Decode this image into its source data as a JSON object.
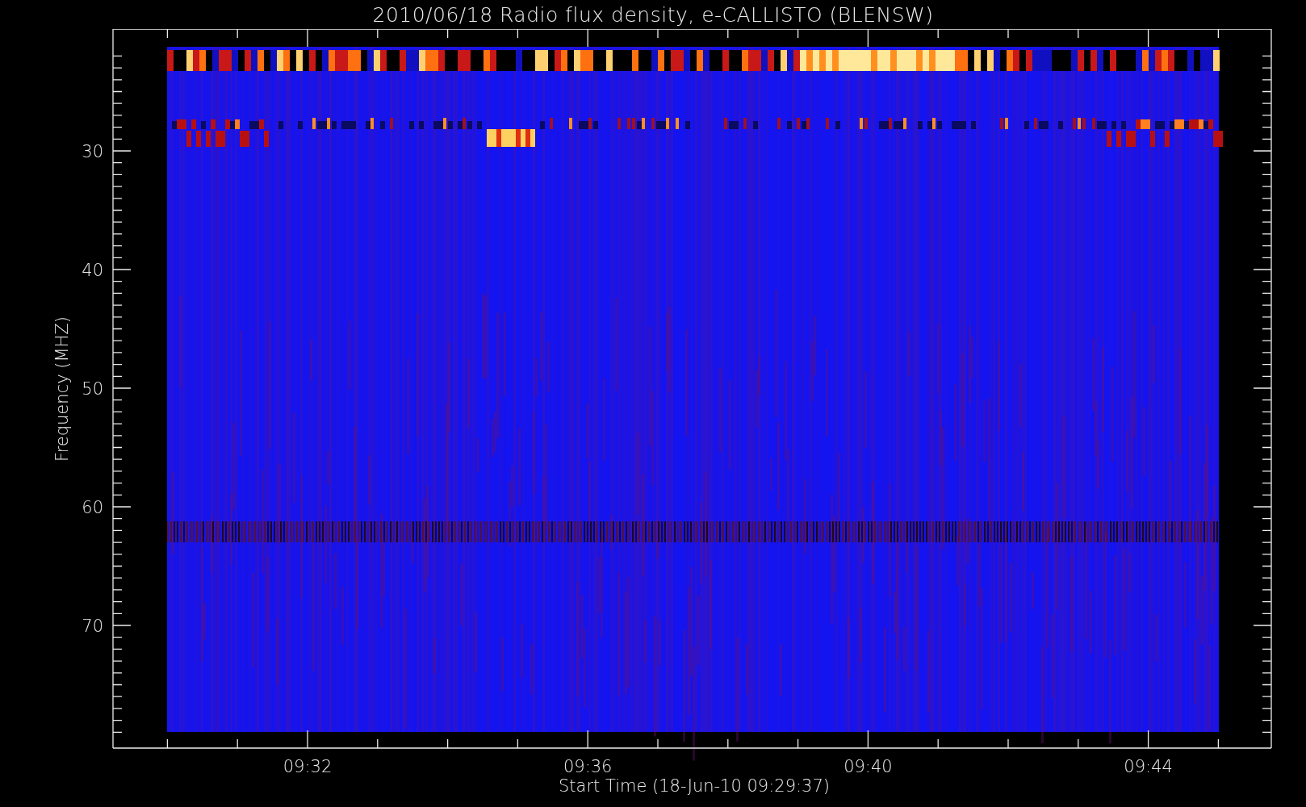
{
  "title": "2010/06/18  Radio flux density, e-CALLISTO (BLENSW)",
  "y_axis": {
    "label": "Frequency (MHZ)",
    "tick_labels": [
      "30",
      "40",
      "50",
      "60",
      "70"
    ]
  },
  "x_axis": {
    "label": "Start Time (18-Jun-10 09:29:37)",
    "tick_labels": [
      "09:32",
      "09:36",
      "09:40",
      "09:44"
    ]
  }
}
